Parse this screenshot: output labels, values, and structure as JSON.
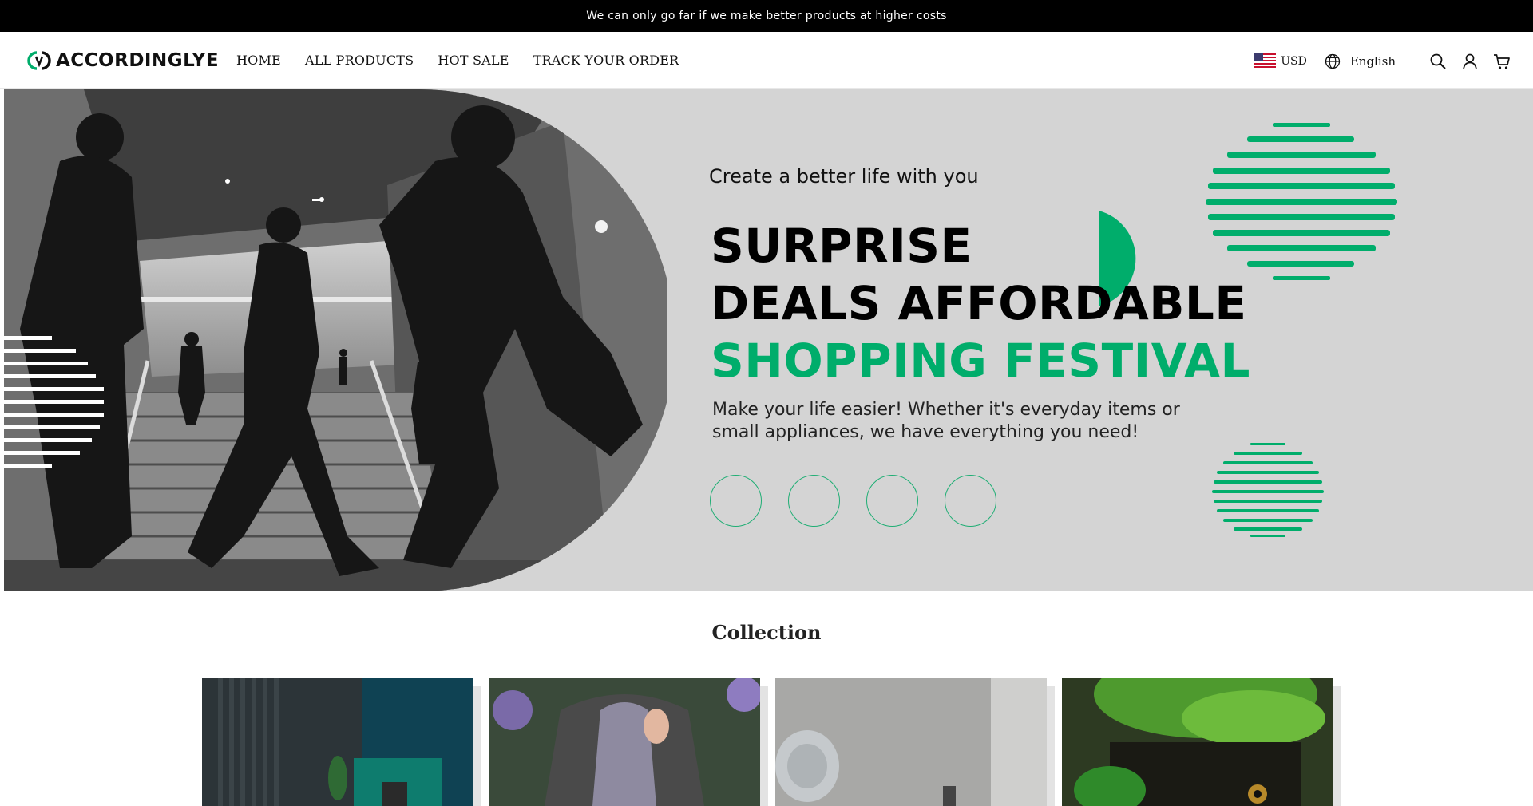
{
  "announcement": "We can only go far if we make better products at higher costs",
  "brand": {
    "name": "ACCORDINGLYE",
    "accent": "#00ad6b"
  },
  "nav": [
    {
      "label": "HOME"
    },
    {
      "label": "ALL PRODUCTS"
    },
    {
      "label": "HOT SALE"
    },
    {
      "label": "TRACK YOUR ORDER"
    }
  ],
  "header_right": {
    "currency": "USD",
    "currency_flag": "us-flag-icon",
    "language": "English",
    "icons": [
      "globe-icon",
      "search-icon",
      "account-icon",
      "cart-icon"
    ]
  },
  "hero": {
    "subtitle": "Create a better life with you",
    "headline_line1": "SURPRISE",
    "headline_line2": "DEALS AFFORDABLE",
    "headline_line3": "SHOPPING FESTIVAL",
    "description": "Make your life easier! Whether it's everyday items or small appliances, we have everything you need!",
    "slide_count": 4
  },
  "collection": {
    "title": "Collection",
    "cards": [
      {
        "name": "collection-card-home-decor"
      },
      {
        "name": "collection-card-apparel"
      },
      {
        "name": "collection-card-bath"
      },
      {
        "name": "collection-card-pets"
      }
    ]
  }
}
